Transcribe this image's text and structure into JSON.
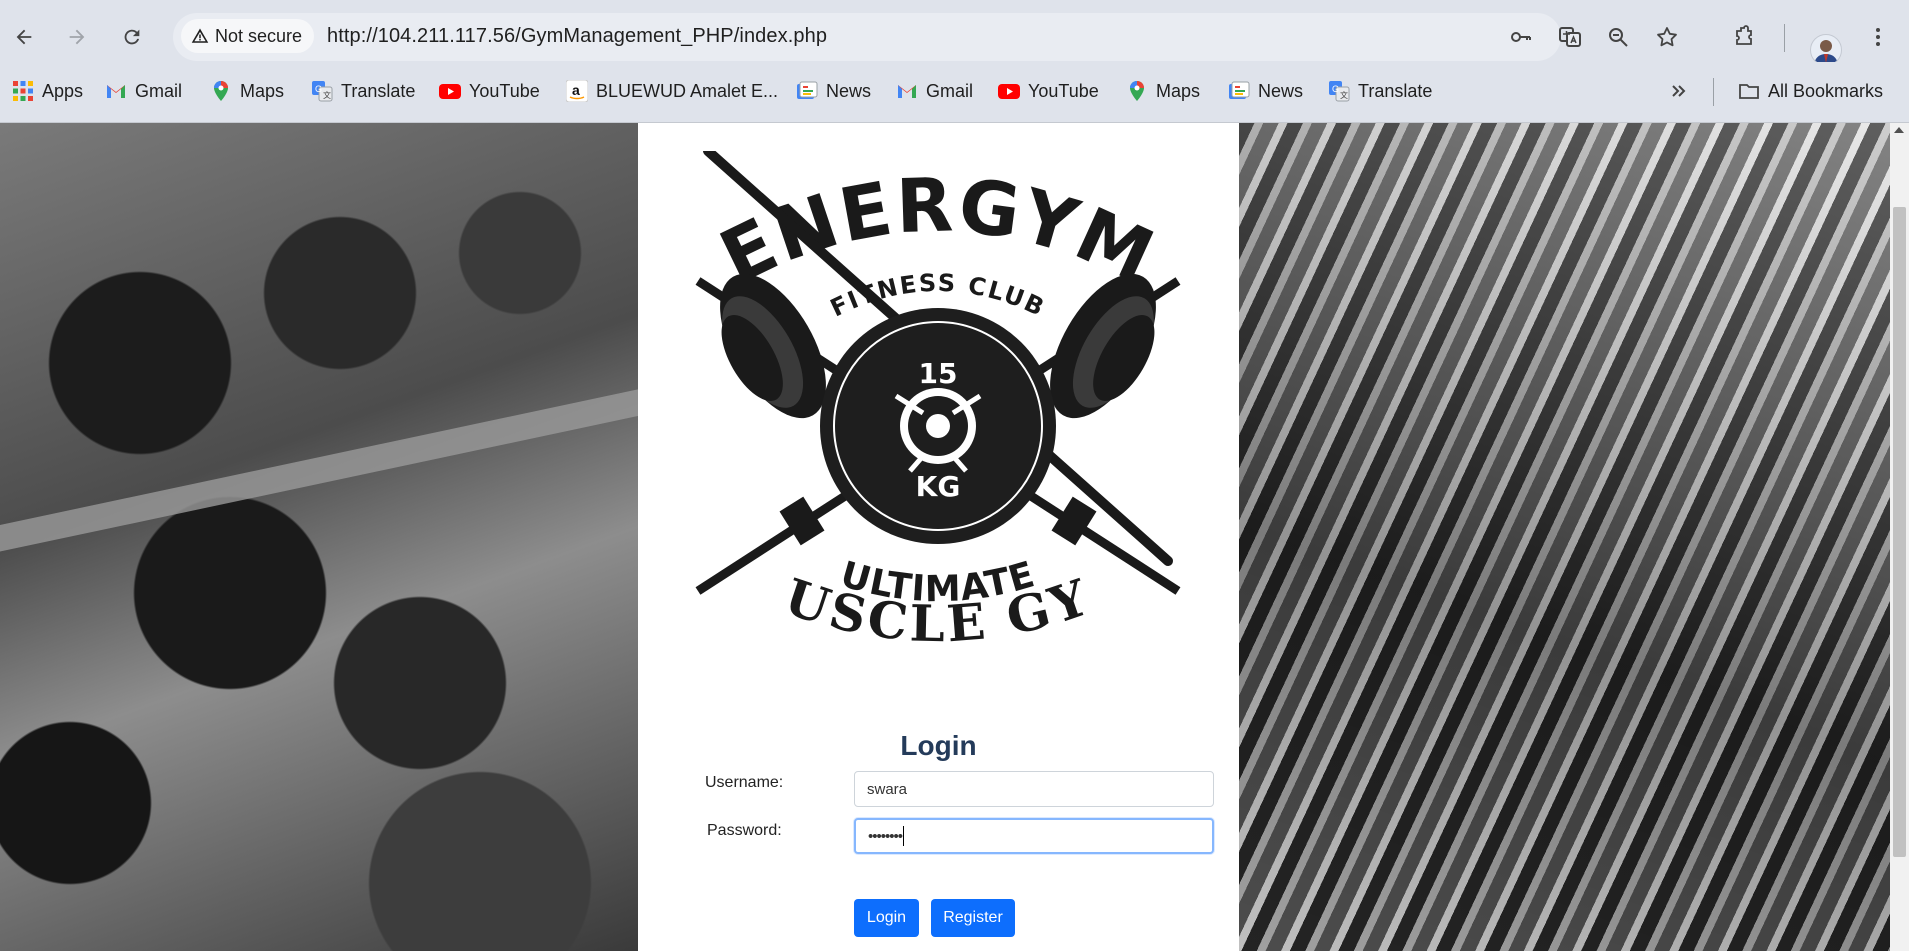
{
  "browser": {
    "security_label": "Not secure",
    "url": "http://104.211.117.56/GymManagement_PHP/index.php",
    "bookmarks": [
      {
        "label": "Apps",
        "icon": "apps-grid-icon"
      },
      {
        "label": "Gmail",
        "icon": "gmail-icon"
      },
      {
        "label": "Maps",
        "icon": "maps-icon"
      },
      {
        "label": "Translate",
        "icon": "translate-icon"
      },
      {
        "label": "YouTube",
        "icon": "youtube-icon"
      },
      {
        "label": "BLUEWUD Amalet E...",
        "icon": "amazon-icon"
      },
      {
        "label": "News",
        "icon": "news-icon"
      },
      {
        "label": "Gmail",
        "icon": "gmail-icon"
      },
      {
        "label": "YouTube",
        "icon": "youtube-icon"
      },
      {
        "label": "Maps",
        "icon": "maps-icon"
      },
      {
        "label": "News",
        "icon": "news-icon"
      },
      {
        "label": "Translate",
        "icon": "translate-icon"
      }
    ],
    "all_bookmarks_label": "All Bookmarks"
  },
  "logo": {
    "brand": "ENERGYM",
    "tagline_top": "FITNESS CLUB",
    "plate_top": "15",
    "plate_bottom": "KG",
    "tagline_mid": "ULTIMATE",
    "tagline_bottom": "MUSCLE GYM"
  },
  "login": {
    "title": "Login",
    "username_label": "Username:",
    "username_value": "swara",
    "password_label": "Password:",
    "password_value": "••••••••",
    "login_button": "Login",
    "register_button": "Register"
  },
  "colors": {
    "primary": "#0d6efd",
    "title": "#243b5a",
    "chrome_bg": "#dfe3eb"
  }
}
